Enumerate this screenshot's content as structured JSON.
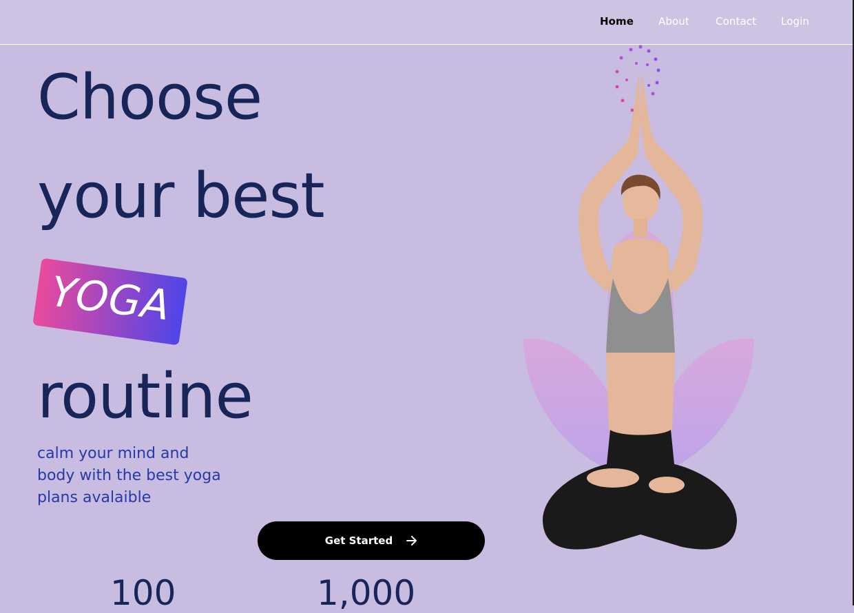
{
  "nav": {
    "items": [
      {
        "label": "Home",
        "active": true
      },
      {
        "label": "About",
        "active": false
      },
      {
        "label": "Contact",
        "active": false
      },
      {
        "label": "Login",
        "active": false
      }
    ]
  },
  "hero": {
    "line1": "Choose",
    "line2": "your best",
    "badge": "YOGA",
    "line3": "routine",
    "tagline": [
      "calm your mind and",
      "body with the best yoga",
      "plans avalaible"
    ],
    "cta_label": "Get Started",
    "cta_icon": "arrow-right-icon"
  },
  "stats": [
    "100",
    "1,000"
  ],
  "colors": {
    "background": "#c8bce0",
    "navbar": "#cdc4e4",
    "headline": "#182558",
    "tagline": "#2639a8",
    "badge_start": "#ea4a9c",
    "badge_end": "#4f45e8",
    "button": "#000000"
  }
}
